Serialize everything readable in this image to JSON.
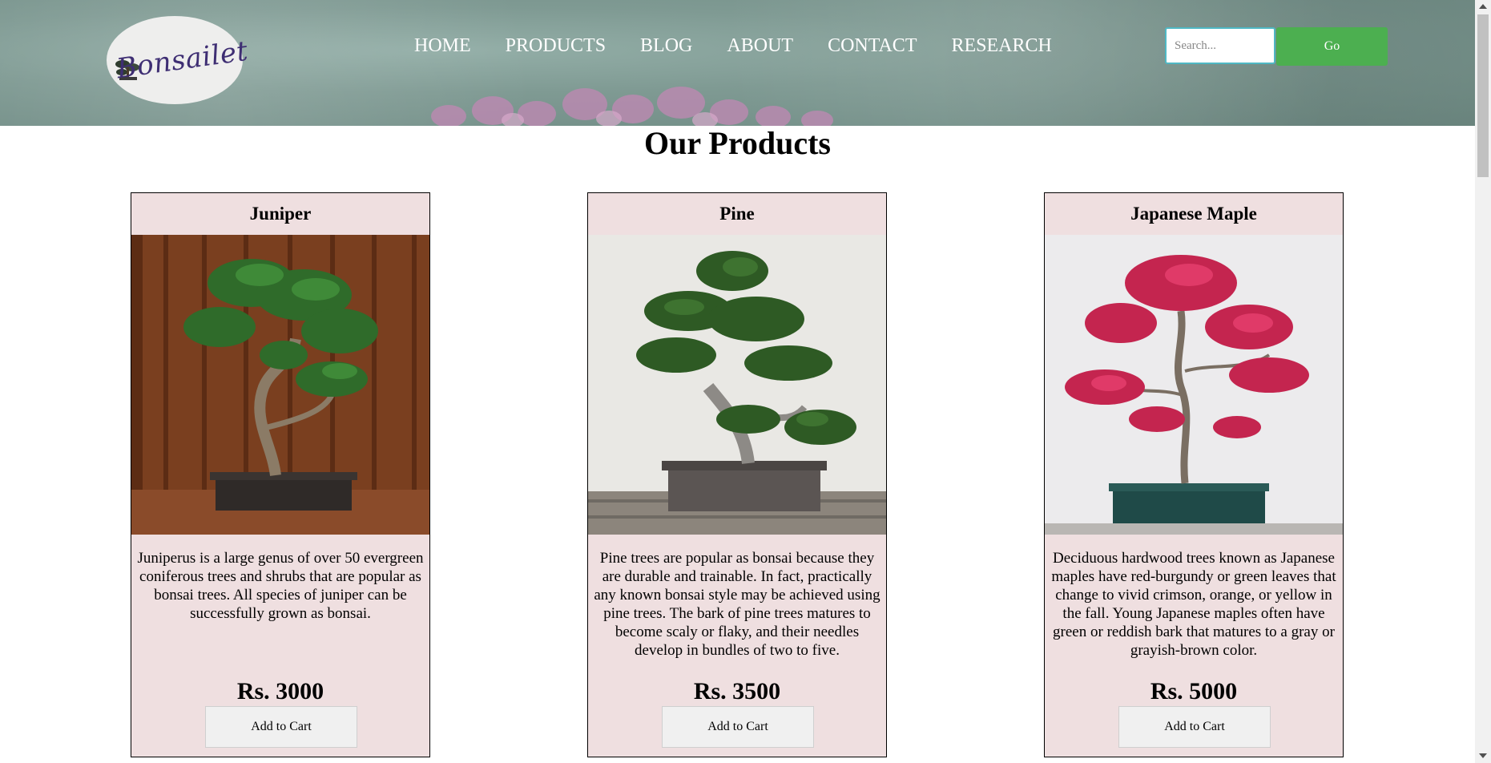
{
  "brand": {
    "logo_text": "Bonsailet"
  },
  "nav": {
    "items": [
      {
        "label": "HOME"
      },
      {
        "label": "PRODUCTS"
      },
      {
        "label": "BLOG"
      },
      {
        "label": "ABOUT"
      },
      {
        "label": "CONTACT"
      },
      {
        "label": "RESEARCH"
      }
    ]
  },
  "search": {
    "placeholder": "Search...",
    "button_label": "Go"
  },
  "page": {
    "title": "Our Products"
  },
  "products": [
    {
      "name": "Juniper",
      "description": "Juniperus is a large genus of over 50 evergreen coniferous trees and shrubs that are popular as bonsai trees. All species of juniper can be successfully grown as bonsai.",
      "price": "Rs. 3000",
      "button_label": "Add to Cart"
    },
    {
      "name": "Pine",
      "description": "Pine trees are popular as bonsai because they are durable and trainable. In fact, practically any known bonsai style may be achieved using pine trees. The bark of pine trees matures to become scaly or flaky, and their needles develop in bundles of two to five.",
      "price": "Rs. 3500",
      "button_label": "Add to Cart"
    },
    {
      "name": "Japanese Maple",
      "description": "Deciduous hardwood trees known as Japanese maples have red-burgundy or green leaves that change to vivid crimson, orange, or yellow in the fall. Young Japanese maples often have green or reddish bark that matures to a gray or grayish-brown color.",
      "price": "Rs. 5000",
      "button_label": "Add to Cart"
    }
  ],
  "colors": {
    "header_bg": "#7f9a93",
    "card_bg": "#efdfe0",
    "go_button": "#4caf50",
    "logo_text": "#3e2e73"
  }
}
